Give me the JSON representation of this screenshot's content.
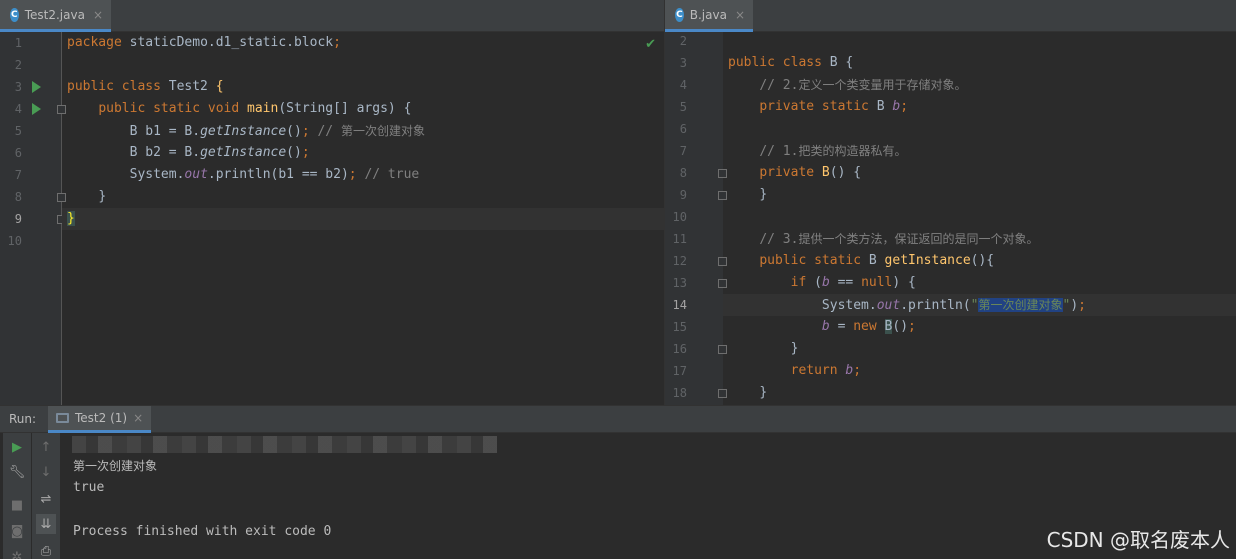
{
  "left_editor": {
    "tab": {
      "name": "Test2.java",
      "icon": "C",
      "close": "×"
    },
    "line_numbers": [
      "1",
      "2",
      "3",
      "4",
      "5",
      "6",
      "7",
      "8",
      "9",
      "10"
    ],
    "lines": [
      {
        "package_kw": "package",
        "package_name": " staticDemo.d1_static.block",
        "semi": ";"
      },
      {},
      {
        "kw": "public class",
        "name": " Test2 ",
        "brace": "{"
      },
      {
        "kw": "public static void",
        "fn": "main",
        "params": "(String[] args) {"
      },
      {
        "pre": "B b1 = B.",
        "method": "getInstance",
        "post": "()",
        "semi": ";",
        "comment": " // ",
        "comment_cn": "第一次创建对象"
      },
      {
        "pre": "B b2 = B.",
        "method": "getInstance",
        "post": "()",
        "semi": ";"
      },
      {
        "pre": "System.",
        "static_field": "out",
        "post": ".println(b1 == b2)",
        "semi": ";",
        "comment": " // true"
      },
      {
        "text": "}"
      },
      {
        "brace": "}"
      },
      {}
    ]
  },
  "right_editor": {
    "tab": {
      "name": "B.java",
      "icon": "C",
      "close": "×"
    },
    "line_numbers": [
      "2",
      "3",
      "4",
      "5",
      "6",
      "7",
      "8",
      "9",
      "10",
      "11",
      "12",
      "13",
      "14",
      "15",
      "16",
      "17",
      "18"
    ],
    "lines": [
      {},
      {
        "kw": "public class",
        "name": " B {"
      },
      {
        "comment": "// 2.",
        "comment_cn": "定义一个类变量用于存储对象。"
      },
      {
        "kw": "private static",
        "type": " B ",
        "field": "b",
        "semi": ";"
      },
      {},
      {
        "comment": "// 1.",
        "comment_cn": "把类的构造器私有。"
      },
      {
        "kw": "private",
        "fn": " B",
        "post": "() {"
      },
      {
        "text": "}"
      },
      {},
      {
        "comment": "// 3.",
        "comment_cn": "提供一个类方法，保证返回的是同一个对象。"
      },
      {
        "kw": "public static",
        "type": " B ",
        "fn": "getInstance",
        "post": "(){"
      },
      {
        "kw": "if",
        "pre": " (",
        "field": "b",
        "mid": " == ",
        "kw2": "null",
        "post": ") {"
      },
      {
        "pre": "System.",
        "static_field": "out",
        "mid": ".println(",
        "q1": "\"",
        "str": "第一次创建对象",
        "q2": "\"",
        "post": ")",
        "semi": ";"
      },
      {
        "field": "b",
        "mid": " = ",
        "kw": "new",
        "pre": " ",
        "cls": "B",
        "post": "()",
        "semi": ";"
      },
      {
        "text": "}"
      },
      {
        "kw": "return",
        "pre": " ",
        "field": "b",
        "semi": ";"
      },
      {
        "text": "}"
      }
    ]
  },
  "run_panel": {
    "label": "Run:",
    "tab": {
      "name": "Test2 (1)",
      "close": "×"
    },
    "output": [
      "第一次创建对象",
      "true",
      "",
      "Process finished with exit code 0"
    ]
  },
  "watermark": "CSDN @取名废本人",
  "colors": {
    "background": "#2b2b2b",
    "keyword": "#cc7832",
    "function": "#ffc66d",
    "static_field": "#9876aa",
    "comment": "#808080",
    "string": "#6a8759",
    "selection": "#214283",
    "run_green": "#499c54",
    "tab_accent": "#4a88c7"
  },
  "icons": [
    "java-class-icon",
    "run-gutter-icon",
    "fold-icon",
    "checkmark-icon",
    "rerun-icon",
    "wrench-icon",
    "stop-icon",
    "camera-icon",
    "arrow-up-icon",
    "arrow-down-icon",
    "soft-wrap-icon",
    "scroll-to-end-icon",
    "print-icon",
    "console-icon"
  ]
}
